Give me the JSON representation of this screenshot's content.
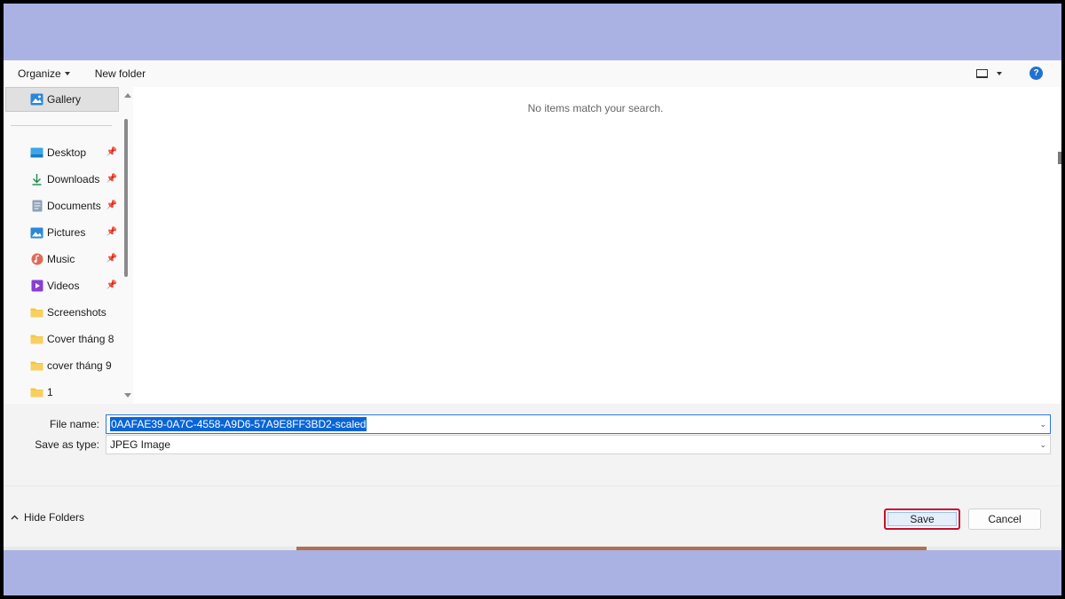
{
  "toolbar": {
    "organize_label": "Organize",
    "new_folder_label": "New folder",
    "view_icon": "view-icon",
    "help_label": "?"
  },
  "nav": {
    "items": [
      {
        "label": "Gallery",
        "icon": "gallery-icon",
        "pinned": false,
        "selected": true
      },
      {
        "label": "Desktop",
        "icon": "desktop-icon",
        "pinned": true
      },
      {
        "label": "Downloads",
        "icon": "download-icon",
        "pinned": true
      },
      {
        "label": "Documents",
        "icon": "documents-icon",
        "pinned": true
      },
      {
        "label": "Pictures",
        "icon": "pictures-icon",
        "pinned": true
      },
      {
        "label": "Music",
        "icon": "music-icon",
        "pinned": true
      },
      {
        "label": "Videos",
        "icon": "videos-icon",
        "pinned": true
      },
      {
        "label": "Screenshots",
        "icon": "folder-icon",
        "pinned": false
      },
      {
        "label": "Cover tháng 8",
        "icon": "folder-icon",
        "pinned": false
      },
      {
        "label": "cover tháng 9",
        "icon": "folder-icon",
        "pinned": false
      },
      {
        "label": "1",
        "icon": "folder-icon",
        "pinned": false
      }
    ]
  },
  "content": {
    "empty_message": "No items match your search."
  },
  "form": {
    "file_name_label": "File name:",
    "file_name_value": "0AAFAE39-0A7C-4558-A9D6-57A9E8FF3BD2-scaled",
    "save_type_label": "Save as type:",
    "save_type_value": "JPEG Image"
  },
  "footer": {
    "hide_folders_label": "Hide Folders",
    "save_label": "Save",
    "cancel_label": "Cancel"
  },
  "colors": {
    "frame_bg": "#aab2e3",
    "accent": "#0a64d6",
    "highlight_border": "#c8102e"
  }
}
